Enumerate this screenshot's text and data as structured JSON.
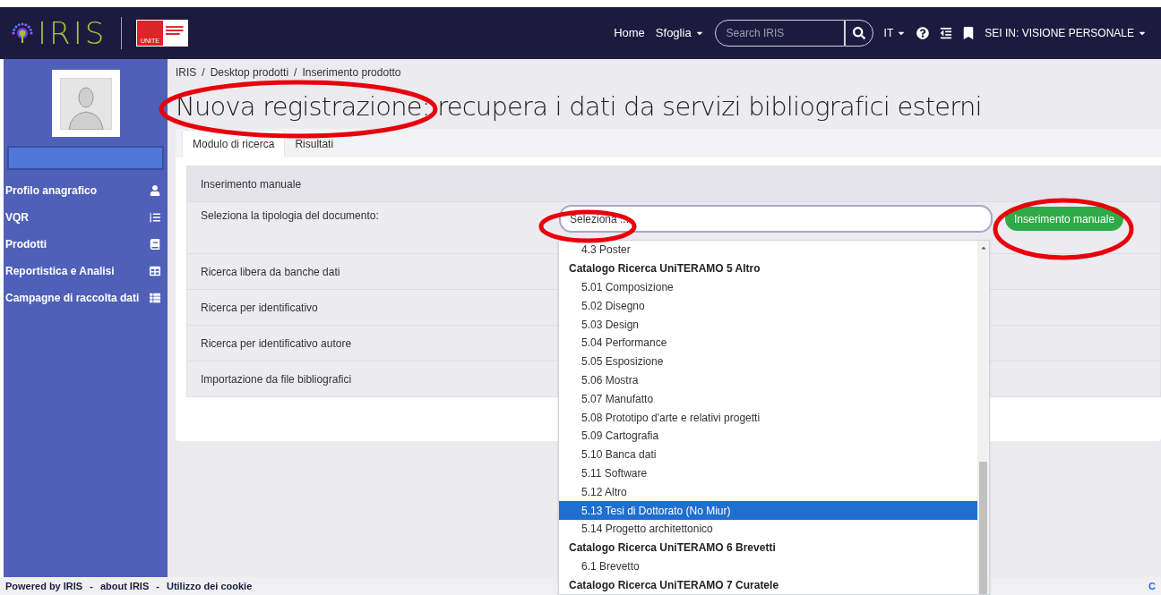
{
  "navbar": {
    "logo": "IRIS",
    "university_logo": "UNITE",
    "links": [
      {
        "label": "Home",
        "dropdown": false
      },
      {
        "label": "Sfoglia",
        "dropdown": true
      }
    ],
    "search": {
      "placeholder": "Search IRIS"
    },
    "language": "IT",
    "profile_menu": "SEI IN: VISIONE PERSONALE"
  },
  "sidebar": {
    "items": [
      {
        "label": "Profilo anagrafico"
      },
      {
        "label": "VQR"
      },
      {
        "label": "Prodotti"
      },
      {
        "label": "Reportistica e Analisi"
      },
      {
        "label": "Campagne di raccolta dati"
      }
    ]
  },
  "breadcrumb": [
    "IRIS",
    "Desktop prodotti",
    "Inserimento prodotto"
  ],
  "breadcrumb_separator": "/",
  "page_title": "Nuova registrazione: recupera i dati da servizi bibliografici esterni",
  "tabs": [
    {
      "label": "Modulo di ricerca",
      "selected": true
    },
    {
      "label": "Risultati",
      "selected": false
    }
  ],
  "sections": [
    {
      "title": "Inserimento manuale",
      "expanded": true,
      "field_label": "Seleziona la tipologia del documento:",
      "select": {
        "placeholder": "Seleziona ..."
      },
      "button": "Inserimento manuale"
    },
    {
      "title": "Ricerca libera da banche dati",
      "expanded": false
    },
    {
      "title": "Ricerca per identificativo",
      "expanded": false
    },
    {
      "title": "Ricerca per identificativo autore",
      "expanded": false
    },
    {
      "title": "Importazione da file bibliografici",
      "expanded": false
    }
  ],
  "dropdown": {
    "items": [
      {
        "kind": "option",
        "label": "4.3 Poster",
        "selected": false
      },
      {
        "kind": "group",
        "label": "Catalogo Ricerca UniTERAMO 5 Altro"
      },
      {
        "kind": "option",
        "label": "5.01 Composizione",
        "selected": false
      },
      {
        "kind": "option",
        "label": "5.02 Disegno",
        "selected": false
      },
      {
        "kind": "option",
        "label": "5.03 Design",
        "selected": false
      },
      {
        "kind": "option",
        "label": "5.04 Performance",
        "selected": false
      },
      {
        "kind": "option",
        "label": "5.05 Esposizione",
        "selected": false
      },
      {
        "kind": "option",
        "label": "5.06 Mostra",
        "selected": false
      },
      {
        "kind": "option",
        "label": "5.07 Manufatto",
        "selected": false
      },
      {
        "kind": "option",
        "label": "5.08 Prototipo d'arte e relativi progetti",
        "selected": false
      },
      {
        "kind": "option",
        "label": "5.09 Cartografia",
        "selected": false
      },
      {
        "kind": "option",
        "label": "5.10 Banca dati",
        "selected": false
      },
      {
        "kind": "option",
        "label": "5.11 Software",
        "selected": false
      },
      {
        "kind": "option",
        "label": "5.12 Altro",
        "selected": false
      },
      {
        "kind": "option",
        "label": "5.13 Tesi di Dottorato (No Miur)",
        "selected": true
      },
      {
        "kind": "option",
        "label": "5.14 Progetto architettonico",
        "selected": false
      },
      {
        "kind": "group",
        "label": "Catalogo Ricerca UniTERAMO 6 Brevetti"
      },
      {
        "kind": "option",
        "label": "6.1 Brevetto",
        "selected": false
      },
      {
        "kind": "group",
        "label": "Catalogo Ricerca UniTERAMO 7 Curatele"
      }
    ]
  },
  "footer": [
    {
      "label": "Powered by IRIS"
    },
    {
      "label": "about IRIS"
    },
    {
      "label": "Utilizzo dei cookie"
    }
  ],
  "footer_separator": "-",
  "footer_right": "C"
}
